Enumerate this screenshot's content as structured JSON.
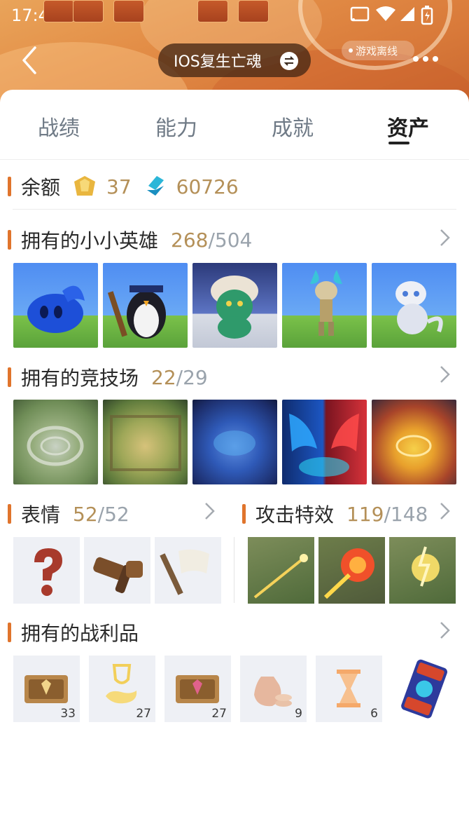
{
  "status_bar": {
    "time": "17:47"
  },
  "header": {
    "title": "IOS复生亡魂",
    "offline_label": "游戏离线"
  },
  "tabs": [
    {
      "label": "战绩",
      "active": false
    },
    {
      "label": "能力",
      "active": false
    },
    {
      "label": "成就",
      "active": false
    },
    {
      "label": "资产",
      "active": true
    }
  ],
  "balance": {
    "label": "余额",
    "coin_amount": "37",
    "gem_amount": "60726"
  },
  "sections": {
    "little_legends": {
      "title": "拥有的小小英雄",
      "owned": "268",
      "total": "/504"
    },
    "arenas": {
      "title": "拥有的竞技场",
      "owned": "22",
      "total": "/29"
    },
    "emotes": {
      "title": "表情",
      "owned": "52",
      "total": "/52"
    },
    "booms": {
      "title": "攻击特效",
      "owned": "119",
      "total": "/148"
    },
    "loot": {
      "title": "拥有的战利品",
      "items": [
        {
          "icon": "ticket-badge-icon",
          "qty": "33"
        },
        {
          "icon": "trophy-hand-icon",
          "qty": "27"
        },
        {
          "icon": "ticket-badge-pink-icon",
          "qty": "27"
        },
        {
          "icon": "coin-bag-icon",
          "qty": "9"
        },
        {
          "icon": "hourglass-icon",
          "qty": "6"
        },
        {
          "icon": "card-pack-icon",
          "qty": ""
        }
      ]
    }
  },
  "colors": {
    "accent_bar": "#e0742c",
    "count_gold": "#b49058",
    "count_grey": "#9aa3ac",
    "header_orange": "#e38e47"
  }
}
